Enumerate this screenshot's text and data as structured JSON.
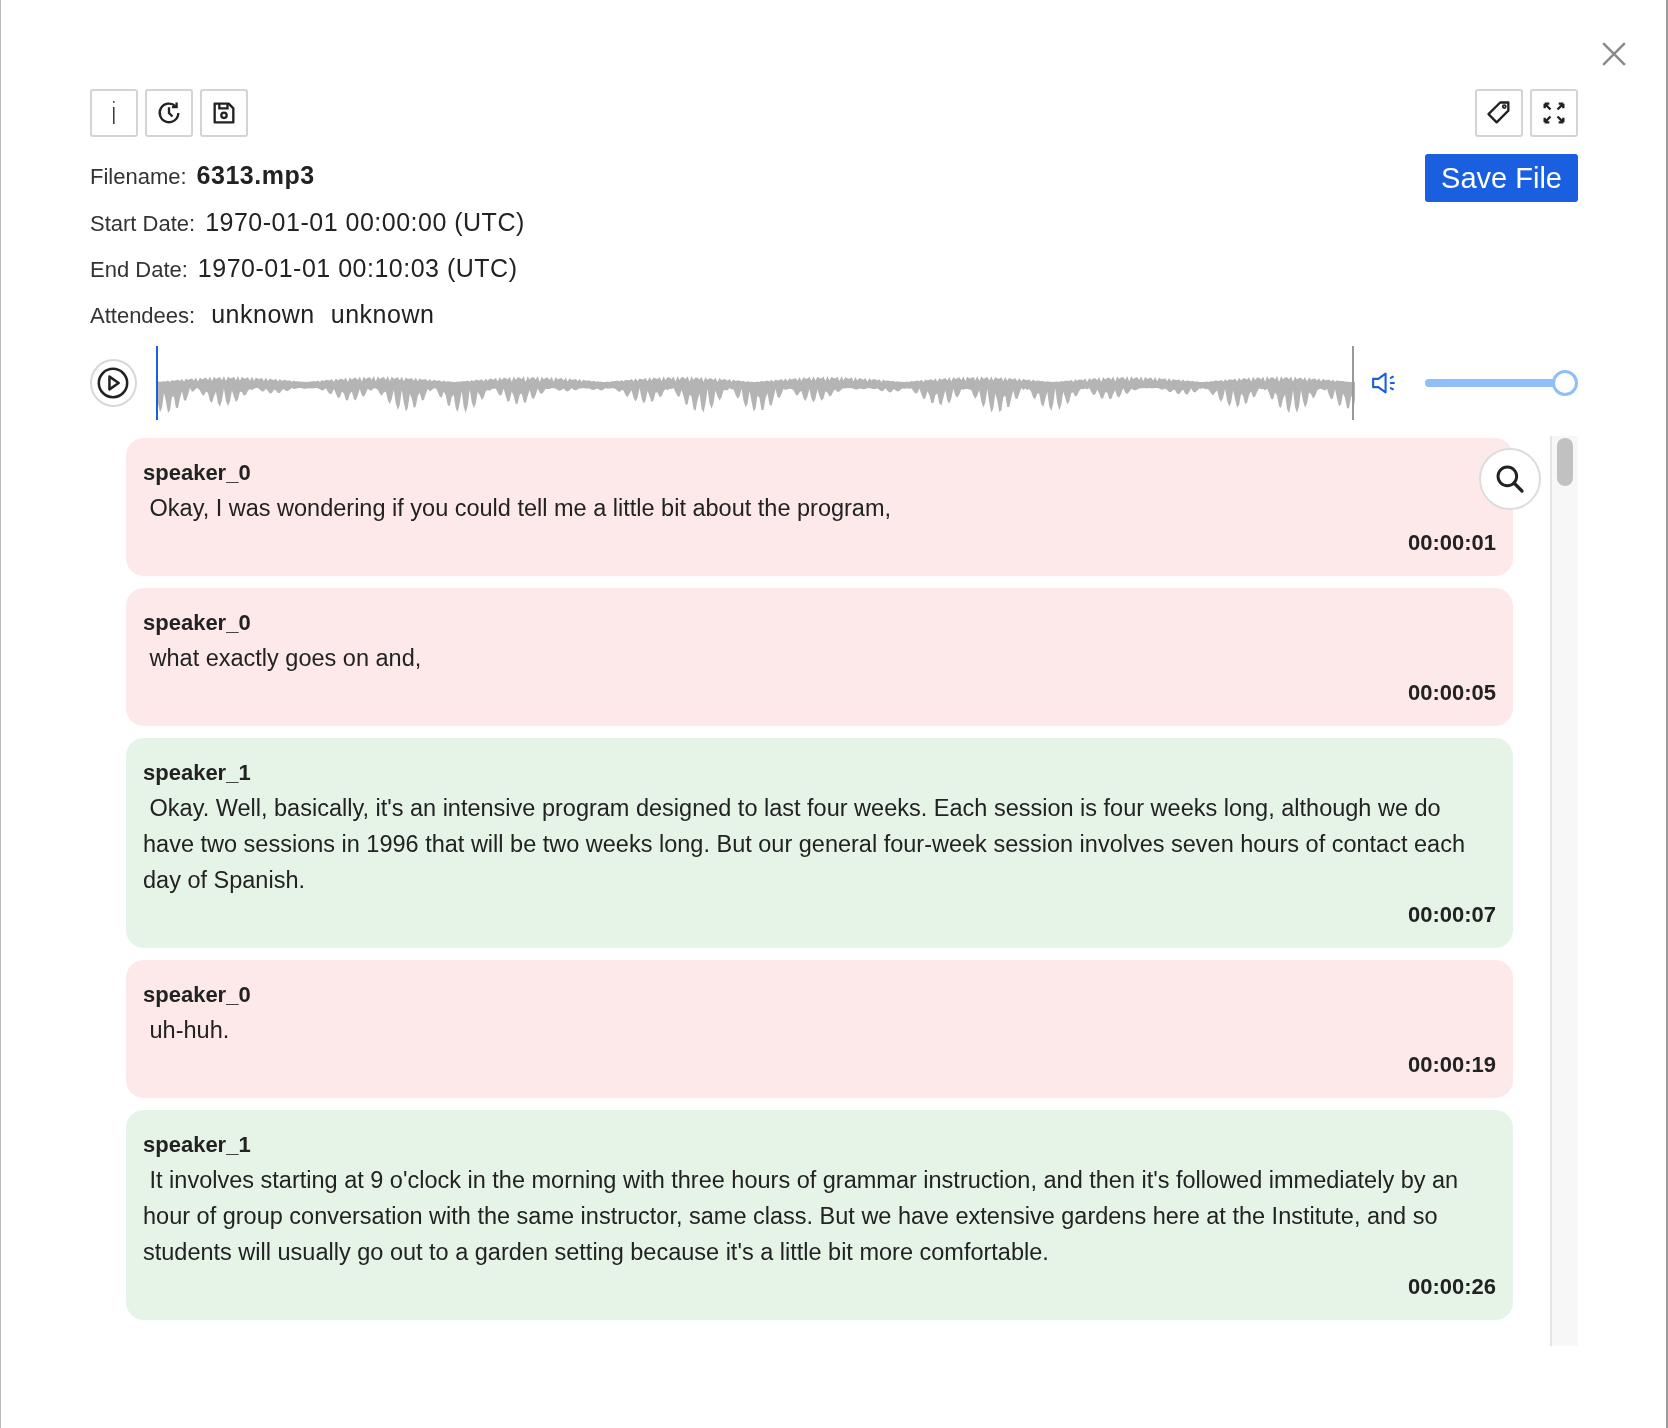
{
  "toolbar": {
    "left_buttons": [
      {
        "kind": "info",
        "label": "i"
      },
      {
        "kind": "history"
      },
      {
        "kind": "save"
      }
    ],
    "right_buttons": [
      {
        "kind": "tag"
      },
      {
        "kind": "expand"
      }
    ]
  },
  "file": {
    "filename_label": "Filename:",
    "filename": "6313.mp3",
    "start_label": "Start Date:",
    "start": "1970-01-01 00:00:00 (UTC)",
    "end_label": "End Date:",
    "end": "1970-01-01 00:10:03 (UTC)",
    "attendees_label": "Attendees:",
    "attendees": [
      "unknown",
      "unknown"
    ]
  },
  "save_button": "Save File",
  "player": {
    "volume": {
      "level": 1
    }
  },
  "transcript": [
    {
      "speaker": "speaker_0",
      "color": "#fde8ea",
      "text": " Okay, I was wondering if you could tell me a little bit about the program,",
      "time": "00:00:01"
    },
    {
      "speaker": "speaker_0",
      "color": "#fde8ea",
      "text": " what exactly goes on and,",
      "time": "00:00:05"
    },
    {
      "speaker": "speaker_1",
      "color": "#e6f4e8",
      "text": " Okay. Well, basically, it's an intensive program designed to last four weeks. Each session is four weeks long, although we do have two sessions in 1996 that will be two weeks long. But our general four-week session involves seven hours of contact each day of Spanish.",
      "time": "00:00:07"
    },
    {
      "speaker": "speaker_0",
      "color": "#fde8ea",
      "text": " uh-huh.",
      "time": "00:00:19"
    },
    {
      "speaker": "speaker_1",
      "color": "#e6f4e8",
      "text": " It involves starting at 9 o'clock in the morning with three hours of grammar instruction, and then it's followed immediately by an hour of group conversation with the same instructor, same class. But we have extensive gardens here at the Institute, and so students will usually go out to a garden setting because it's a little bit more comfortable.",
      "time": "00:00:26"
    }
  ]
}
